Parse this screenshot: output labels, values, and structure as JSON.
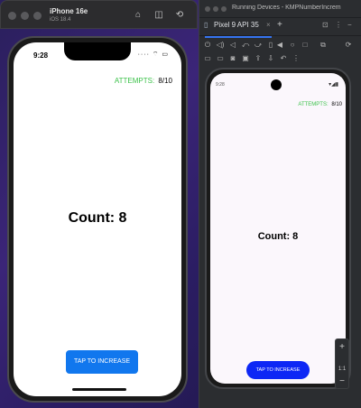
{
  "ios_window": {
    "device_name": "iPhone 16e",
    "os_version": "iOS 18.4",
    "toolbar_icons": [
      "home-icon",
      "screenshot-icon",
      "rotate-icon"
    ]
  },
  "ios_app": {
    "time": "9:28",
    "status_icons": "···· ⌔ ▭",
    "attempts_label": "ATTEMPTS:",
    "attempts_value": "8/10",
    "count_text": "Count: 8",
    "button_label": "TAP TO INCREASE"
  },
  "rd_window": {
    "title": "Running Devices - KMPNumberIncrem",
    "tab_label": "Pixel 9 API 35",
    "tab_close": "×",
    "tab_add": "+"
  },
  "android_app": {
    "time": "9:28",
    "attempts_label": "ATTEMPTS:",
    "attempts_value": "8/10",
    "count_text": "Count: 8",
    "button_label": "TAP TO INCREASE"
  },
  "zoom": {
    "zoom_in": "+",
    "zoom_ratio": "1:1",
    "zoom_out": "−"
  },
  "colors": {
    "ios_button": "#1177ee",
    "android_button": "#0d27f5",
    "attempts_label": "#3cc24a"
  }
}
